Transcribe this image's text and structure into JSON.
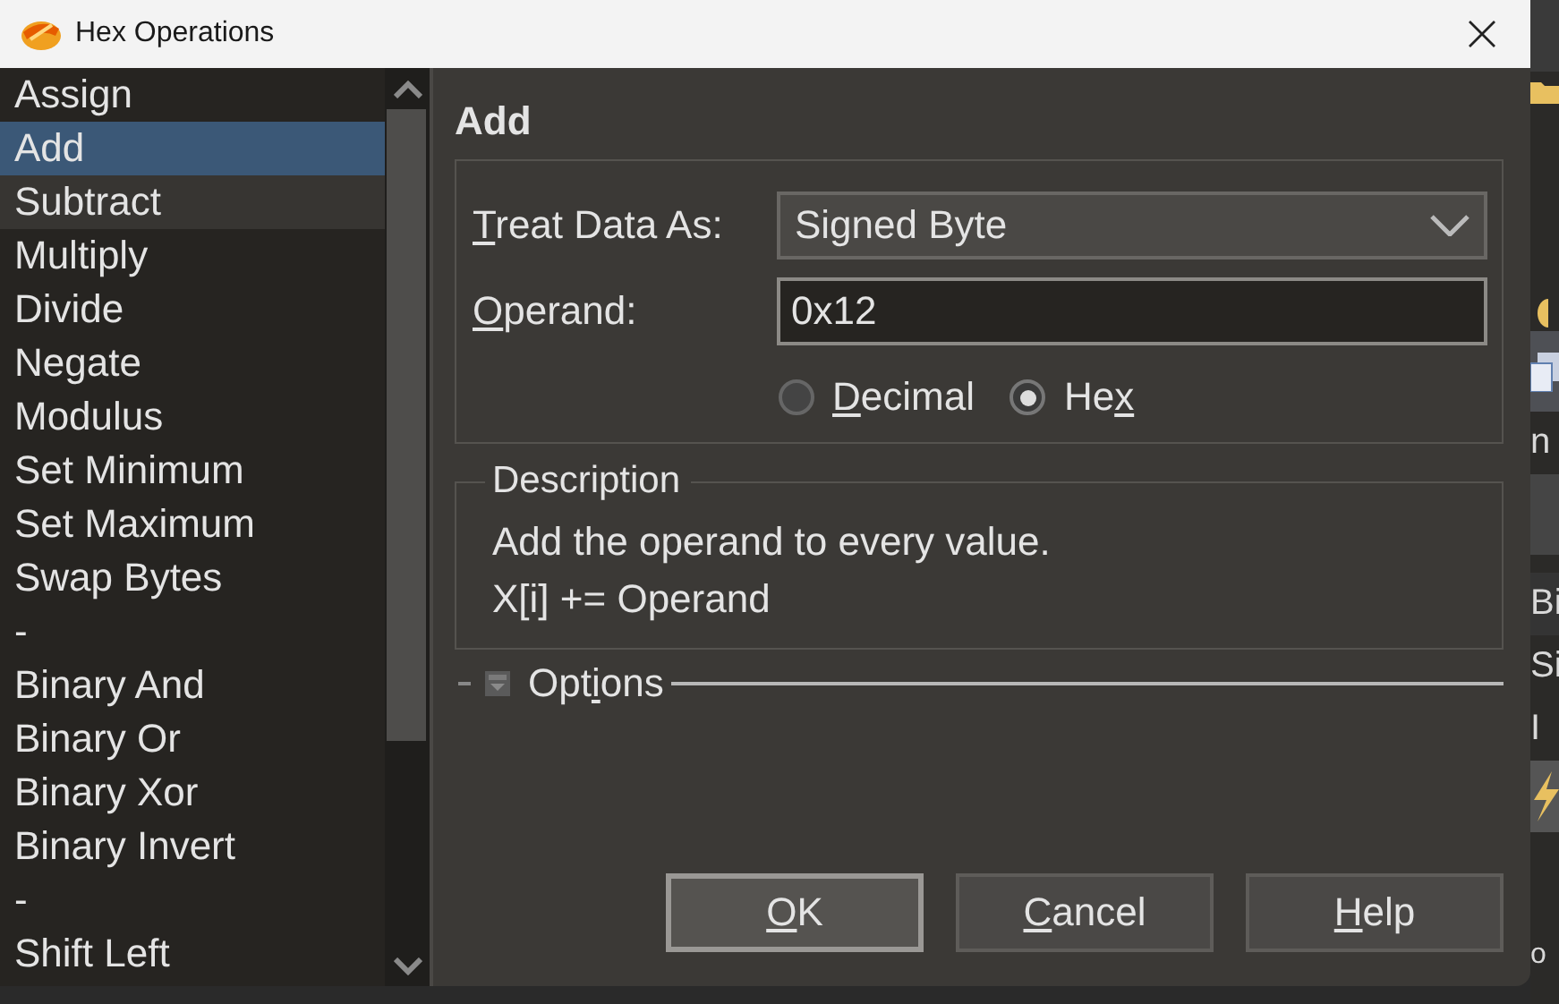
{
  "window": {
    "title": "Hex Operations"
  },
  "operations": {
    "items": [
      {
        "label": "Assign",
        "selected": false,
        "hovered": false
      },
      {
        "label": "Add",
        "selected": true,
        "hovered": false
      },
      {
        "label": "Subtract",
        "selected": false,
        "hovered": true
      },
      {
        "label": "Multiply",
        "selected": false,
        "hovered": false
      },
      {
        "label": "Divide",
        "selected": false,
        "hovered": false
      },
      {
        "label": "Negate",
        "selected": false,
        "hovered": false
      },
      {
        "label": "Modulus",
        "selected": false,
        "hovered": false
      },
      {
        "label": "Set Minimum",
        "selected": false,
        "hovered": false
      },
      {
        "label": "Set Maximum",
        "selected": false,
        "hovered": false
      },
      {
        "label": "Swap Bytes",
        "selected": false,
        "hovered": false
      },
      {
        "label": "-",
        "selected": false,
        "hovered": false
      },
      {
        "label": "Binary And",
        "selected": false,
        "hovered": false
      },
      {
        "label": "Binary Or",
        "selected": false,
        "hovered": false
      },
      {
        "label": "Binary Xor",
        "selected": false,
        "hovered": false
      },
      {
        "label": "Binary Invert",
        "selected": false,
        "hovered": false
      },
      {
        "label": "-",
        "selected": false,
        "hovered": false
      },
      {
        "label": "Shift Left",
        "selected": false,
        "hovered": false
      }
    ]
  },
  "panel": {
    "heading": "Add",
    "treat_data_as": {
      "label": {
        "key": "T",
        "after": "reat Data As:"
      },
      "value": "Signed Byte"
    },
    "operand": {
      "label": {
        "key": "O",
        "after": "perand:"
      },
      "value": "0x12"
    },
    "radios": [
      {
        "label": {
          "key": "D",
          "after": "ecimal"
        },
        "selected": false
      },
      {
        "label": {
          "before": "He",
          "key": "x"
        },
        "selected": true
      }
    ],
    "description": {
      "legend": "Description",
      "lines": [
        "Add the operand to every value.",
        "X[i] += Operand"
      ]
    },
    "options": {
      "label": {
        "before": "Opt",
        "key": "i",
        "after": "ons"
      },
      "expanded": false
    }
  },
  "buttons": [
    {
      "label": {
        "key": "O",
        "after": "K"
      },
      "default": true
    },
    {
      "label": {
        "key": "C",
        "after": "ancel"
      },
      "default": false
    },
    {
      "label": {
        "key": "H",
        "after": "elp"
      },
      "default": false
    }
  ],
  "background_window": {
    "texts": [
      "n",
      "Bi",
      "Si",
      "I",
      "o"
    ]
  }
}
